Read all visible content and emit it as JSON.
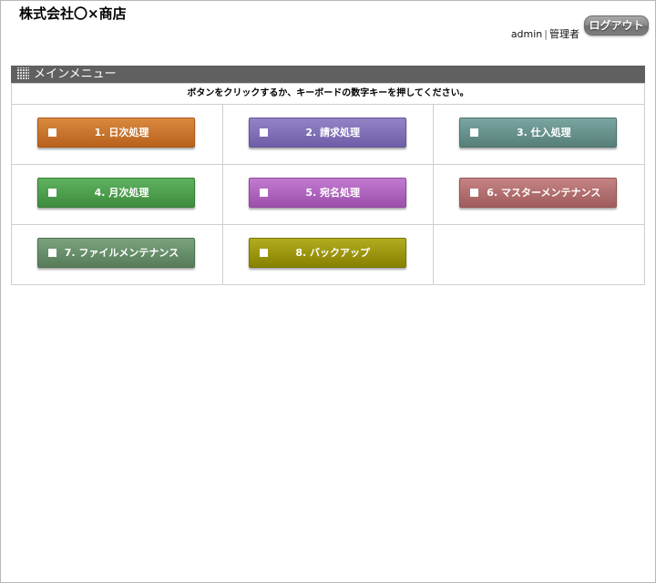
{
  "header": {
    "company_name": "株式会社〇×商店",
    "user_name": "admin",
    "user_separator": "|",
    "user_role": "管理者",
    "logout_label": "ログアウト"
  },
  "main_menu": {
    "title": "メインメニュー",
    "instruction": "ボタンをクリックするか、キーボードの数字キーを押してください。",
    "items": [
      {
        "label": "1. 日次処理",
        "color": "#c8742a"
      },
      {
        "label": "2. 請求処理",
        "color": "#7f6fb7"
      },
      {
        "label": "3. 仕入処理",
        "color": "#68928d"
      },
      {
        "label": "4. 月次処理",
        "color": "#4f9f4f"
      },
      {
        "label": "5. 宛名処理",
        "color": "#ae64be"
      },
      {
        "label": "6. マスターメンテナンス",
        "color": "#b27070"
      },
      {
        "label": "7. ファイルメンテナンス",
        "color": "#688f6b"
      },
      {
        "label": "8. バックアップ",
        "color": "#9c9610"
      }
    ]
  }
}
